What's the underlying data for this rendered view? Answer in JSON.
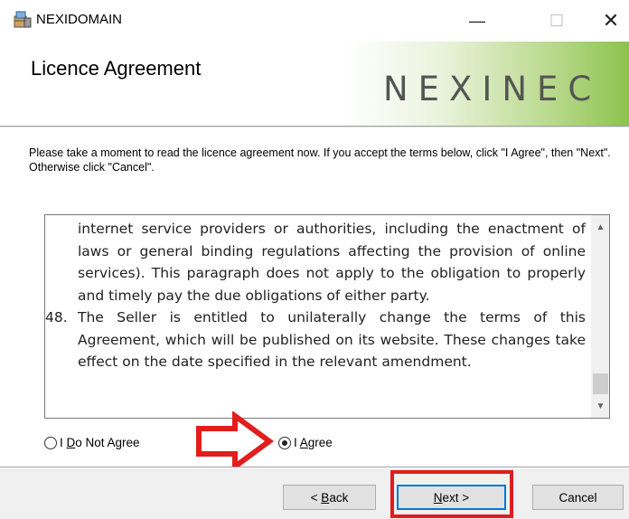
{
  "window": {
    "title": "NEXIDOMAIN",
    "icon": "installer-icon",
    "controls": {
      "minimize": "—",
      "maximize": "☐",
      "close": "✕"
    }
  },
  "header": {
    "title": "Licence Agreement",
    "brand": "NEXINEC",
    "brand_color": "#8cc24e"
  },
  "instruction": "Please take a moment to read the licence agreement now. If you accept the terms below, click \"I Agree\", then \"Next\". Otherwise click \"Cancel\".",
  "license": {
    "continued_text": "internet service providers or authorities, including the enactment of laws or general binding regulations affecting the provision of online services). This paragraph does not apply to the obligation to properly and timely pay the due obligations of either party.",
    "items": [
      {
        "number": "48.",
        "text": "The Seller is entitled to unilaterally change the terms of this Agreement, which will be published on its website. These changes take effect on the date specified in the relevant amendment."
      }
    ]
  },
  "radios": {
    "disagree": {
      "prefix": "I ",
      "mnemonic": "D",
      "rest": "o Not Agree",
      "checked": false
    },
    "agree": {
      "prefix": "I ",
      "mnemonic": "A",
      "rest": "gree",
      "checked": true
    }
  },
  "buttons": {
    "back": {
      "prefix": "< ",
      "mnemonic": "B",
      "rest": "ack"
    },
    "next": {
      "prefix": "",
      "mnemonic": "N",
      "rest": "ext >"
    },
    "cancel": "Cancel"
  },
  "annotations": {
    "arrow_color": "#e11d1d",
    "highlight_color": "#e11d1d"
  }
}
